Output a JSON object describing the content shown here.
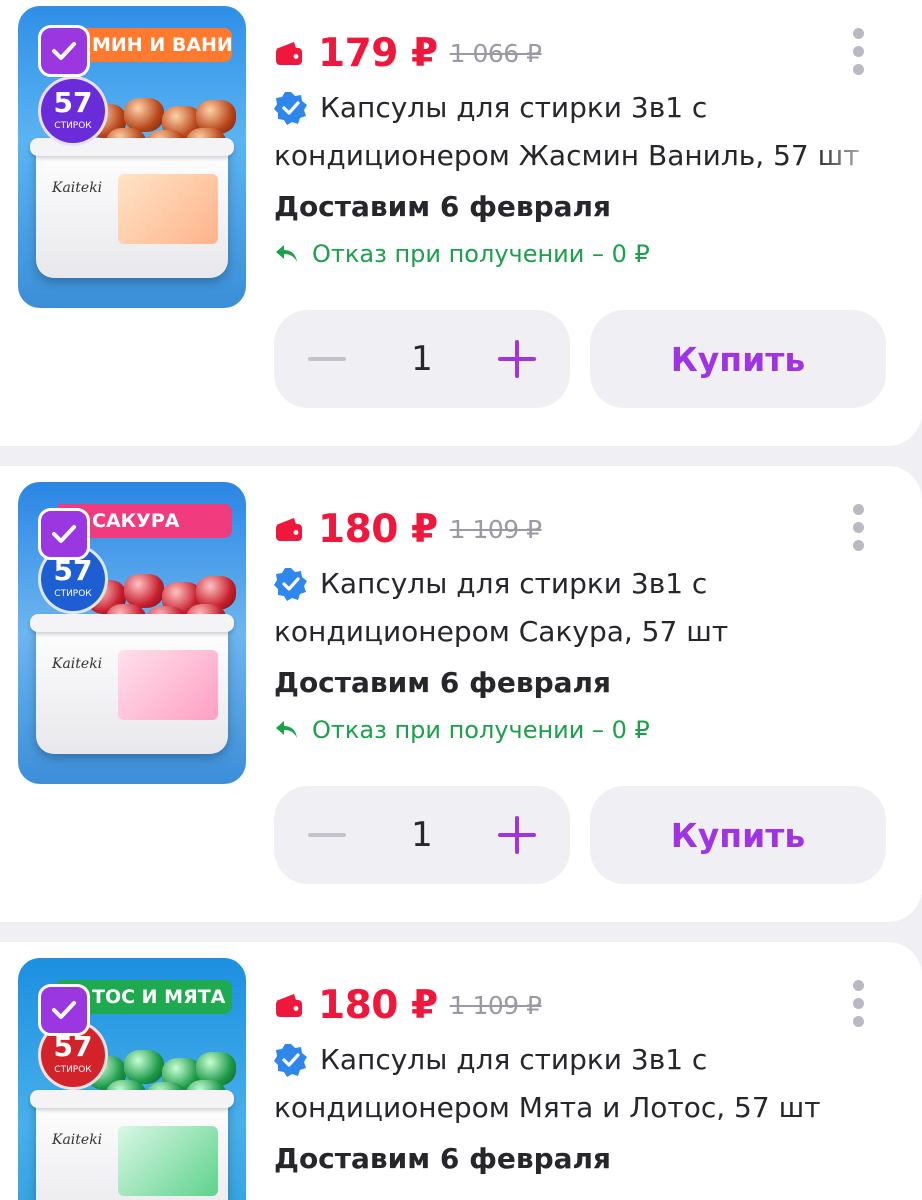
{
  "colors": {
    "price": "#f0173d",
    "accent": "#a034e2",
    "refund": "#1aa14a",
    "verified": "#2f86eb"
  },
  "products": [
    {
      "banner": "МИН И ВАНИЛЬ",
      "badge_number": "57",
      "badge_sub": "СТИРОК",
      "brand": "Kaiteki",
      "price": "179 ₽",
      "old_price": "1 066 ₽",
      "title_line1": "Капсулы для стирки 3в1 с",
      "title_line2": "кондиционером Жасмин Ваниль, 57 шт",
      "delivery": "Доставим 6 февраля",
      "refund": "Отказ при получении – 0 ₽",
      "quantity": "1",
      "buy_label": "Купить"
    },
    {
      "banner": "САКУРА",
      "badge_number": "57",
      "badge_sub": "СТИРОК",
      "brand": "Kaiteki",
      "price": "180 ₽",
      "old_price": "1 109 ₽",
      "title_line1": "Капсулы для стирки 3в1 с",
      "title_line2": "кондиционером Сакура, 57 шт",
      "delivery": "Доставим 6 февраля",
      "refund": "Отказ при получении – 0 ₽",
      "quantity": "1",
      "buy_label": "Купить"
    },
    {
      "banner": "ТОС И МЯТА",
      "badge_number": "57",
      "badge_sub": "СТИРОК",
      "brand": "Kaiteki",
      "price": "180 ₽",
      "old_price": "1 109 ₽",
      "title_line1": "Капсулы для стирки 3в1 с",
      "title_line2": "кондиционером Мята и Лотос, 57 шт",
      "delivery": "Доставим 6 февраля"
    }
  ],
  "icons": {
    "selected": "checkmark-icon",
    "price": "wallet-icon",
    "verified": "verified-badge-icon",
    "refund": "return-arrow-icon",
    "more": "more-vertical-icon",
    "decrease": "minus-icon",
    "increase": "plus-icon"
  }
}
